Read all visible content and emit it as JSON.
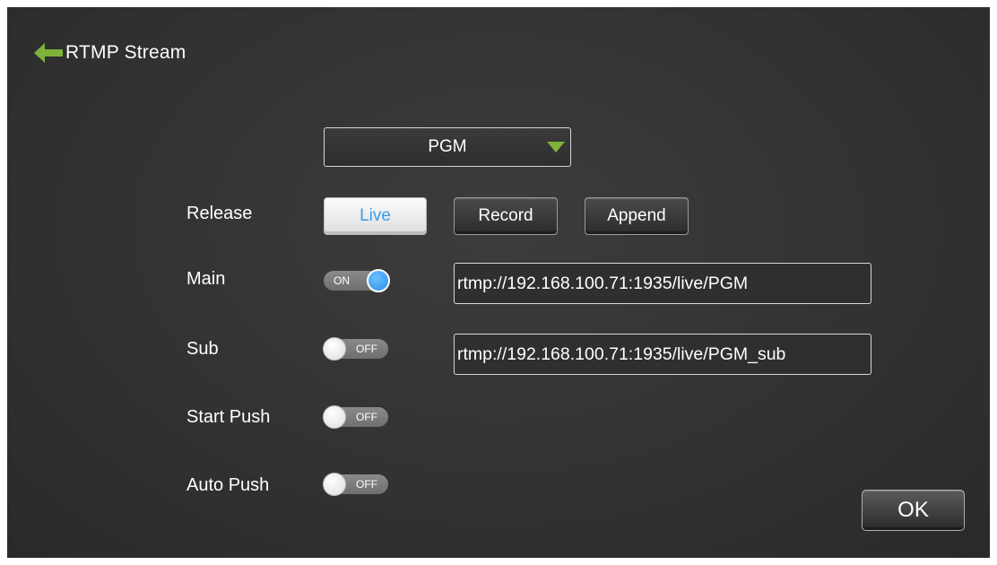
{
  "header": {
    "title": "RTMP Stream",
    "back_icon": "back-arrow-icon",
    "back_icon_color": "#7fb13b"
  },
  "source_select": {
    "value": "PGM",
    "arrow_icon": "dropdown-triangle-icon",
    "arrow_color": "#7fb13b"
  },
  "release": {
    "label": "Release",
    "options": [
      "Live",
      "Record",
      "Append"
    ],
    "selected": "Live",
    "selected_text_color": "#3a9de9"
  },
  "main": {
    "label": "Main",
    "toggle": "ON",
    "url": "rtmp://192.168.100.71:1935/live/PGM"
  },
  "sub": {
    "label": "Sub",
    "toggle": "OFF",
    "url": "rtmp://192.168.100.71:1935/live/PGM_sub"
  },
  "start_push": {
    "label": "Start Push",
    "toggle": "OFF"
  },
  "auto_push": {
    "label": "Auto Push",
    "toggle": "OFF"
  },
  "ok_label": "OK",
  "colors": {
    "accent": "#7fb13b",
    "toggle_on_knob": "#2b8fe8",
    "background": "#333333"
  }
}
